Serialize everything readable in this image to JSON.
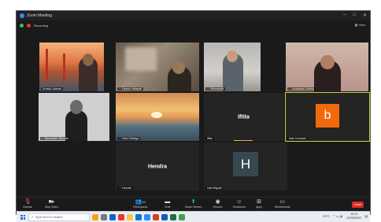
{
  "window": {
    "title": "Zoom Meeting",
    "controls": [
      "–",
      "□",
      "✕"
    ]
  },
  "infobar": {
    "recording_label": "Recording",
    "view_label": "View"
  },
  "participants": [
    {
      "name": "Ernest Lukman"
    },
    {
      "name": "Fayrus Hidayati"
    },
    {
      "name": "Sievensiell"
    },
    {
      "name": "Anastasia Zeferia"
    },
    {
      "name": "Alexander Siburian"
    },
    {
      "name": "Heni Viridaya"
    },
    {
      "name": "Iftita",
      "display": "Iftita"
    },
    {
      "name": "Irfan Kurniadi",
      "avatar": "b"
    },
    {
      "name": "Hendra",
      "display": "Hendra"
    },
    {
      "name": "Hari Wiyadi",
      "avatar": "H"
    }
  ],
  "toolbar": {
    "unmute": "Unmute",
    "stop_video": "Stop Video",
    "participants": "Participants",
    "participants_count": "10",
    "chat": "Chat",
    "share_screen": "Share Screen",
    "record": "Record",
    "reactions": "Reactions",
    "apps": "Apps",
    "whiteboards": "Whiteboards",
    "end": "Leave"
  },
  "taskbar": {
    "search_placeholder": "Type here to search",
    "weather": "29°C",
    "time": "15:42",
    "date": "20/08/2022"
  }
}
